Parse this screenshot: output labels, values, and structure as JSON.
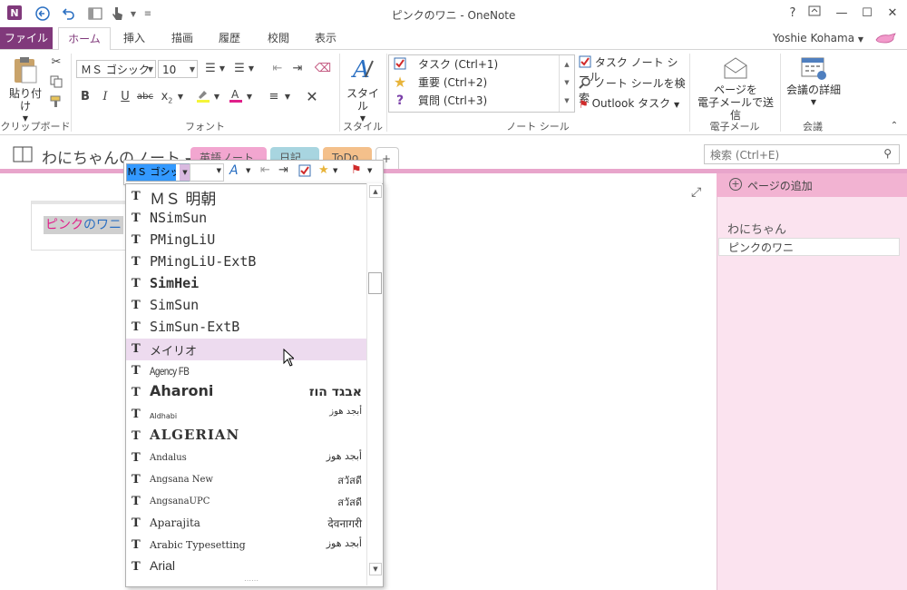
{
  "window": {
    "title": "ピンクのワニ - OneNote",
    "app_icon": "N",
    "user": "Yoshie Kohama",
    "help": "?",
    "controls": {
      "help": "?",
      "restore_ribbon": "⊼",
      "minimize": "—",
      "maximize": "☐",
      "close": "✕"
    }
  },
  "ribbon_tabs": [
    "ファイル",
    "ホーム",
    "挿入",
    "描画",
    "履歴",
    "校閲",
    "表示"
  ],
  "ribbon": {
    "clipboard": {
      "paste": "貼り付け",
      "label": "クリップボード"
    },
    "font": {
      "font_name": "ＭＳ ゴシック",
      "font_size": "10",
      "label": "フォント"
    },
    "style": {
      "style_button": "スタイル",
      "label": "スタイル"
    },
    "tags": {
      "items": [
        {
          "label": "タスク (Ctrl+1)",
          "icon": "checkbox-icon"
        },
        {
          "label": "重要 (Ctrl+2)",
          "icon": "star-icon"
        },
        {
          "label": "質問 (Ctrl+3)",
          "icon": "question-icon"
        }
      ],
      "todo_tag": "タスク ノート シール",
      "find_tags": "ノート シールを検索",
      "outlook_tasks": "Outlook タスク",
      "label": "ノート シール"
    },
    "email": {
      "button_line1": "ページを",
      "button_line2": "電子メールで送信",
      "label": "電子メール"
    },
    "meetings": {
      "button": "会議の詳細",
      "label": "会議"
    }
  },
  "notebook": {
    "name": "わにちゃんのノート",
    "sections": [
      "英語ノート",
      "日記",
      "ToDo"
    ],
    "add_section": "+",
    "search_placeholder": "検索 (Ctrl+E)"
  },
  "page": {
    "title_part1": "ピンク",
    "title_part2": "の",
    "title_part3": "ワニ",
    "expand_icon": "⤢"
  },
  "page_pane": {
    "add_page": "ページの追加",
    "section_title": "わにちゃん",
    "pages": [
      "ピンクのワニ"
    ]
  },
  "mini_toolbar": {
    "font_value": "ＭＳ ゴシック",
    "size_value": ""
  },
  "font_list": {
    "selected": "メイリオ",
    "items": [
      {
        "name": "ＭＳ 明朝",
        "sample": ""
      },
      {
        "name": "NSimSun",
        "sample": ""
      },
      {
        "name": "PMingLiU",
        "sample": ""
      },
      {
        "name": "PMingLiU-ExtB",
        "sample": ""
      },
      {
        "name": "SimHei",
        "sample": ""
      },
      {
        "name": "SimSun",
        "sample": ""
      },
      {
        "name": "SimSun-ExtB",
        "sample": ""
      },
      {
        "name": "メイリオ",
        "sample": ""
      },
      {
        "name": "Agency FB",
        "sample": ""
      },
      {
        "name": "Aharoni",
        "sample": "אבגד הוז"
      },
      {
        "name": "Aldhabi",
        "sample": "أبجد هوز"
      },
      {
        "name": "ALGERIAN",
        "sample": ""
      },
      {
        "name": "Andalus",
        "sample": "أبجد هوز"
      },
      {
        "name": "Angsana New",
        "sample": "สวัสดี"
      },
      {
        "name": "AngsanaUPC",
        "sample": "สวัสดี"
      },
      {
        "name": "Aparajita",
        "sample": "देवनागरी"
      },
      {
        "name": "Arabic Typesetting",
        "sample": "أبجد هوز"
      },
      {
        "name": "Arial",
        "sample": ""
      }
    ]
  },
  "colors": {
    "accent": "#80397b",
    "section_tab_1": "#f2a6d0",
    "section_tab_2": "#a8d5e0",
    "section_tab_3": "#f4c08b",
    "page_pane_bg": "#fbe3ef",
    "selected_font_bg": "#eddbef"
  }
}
